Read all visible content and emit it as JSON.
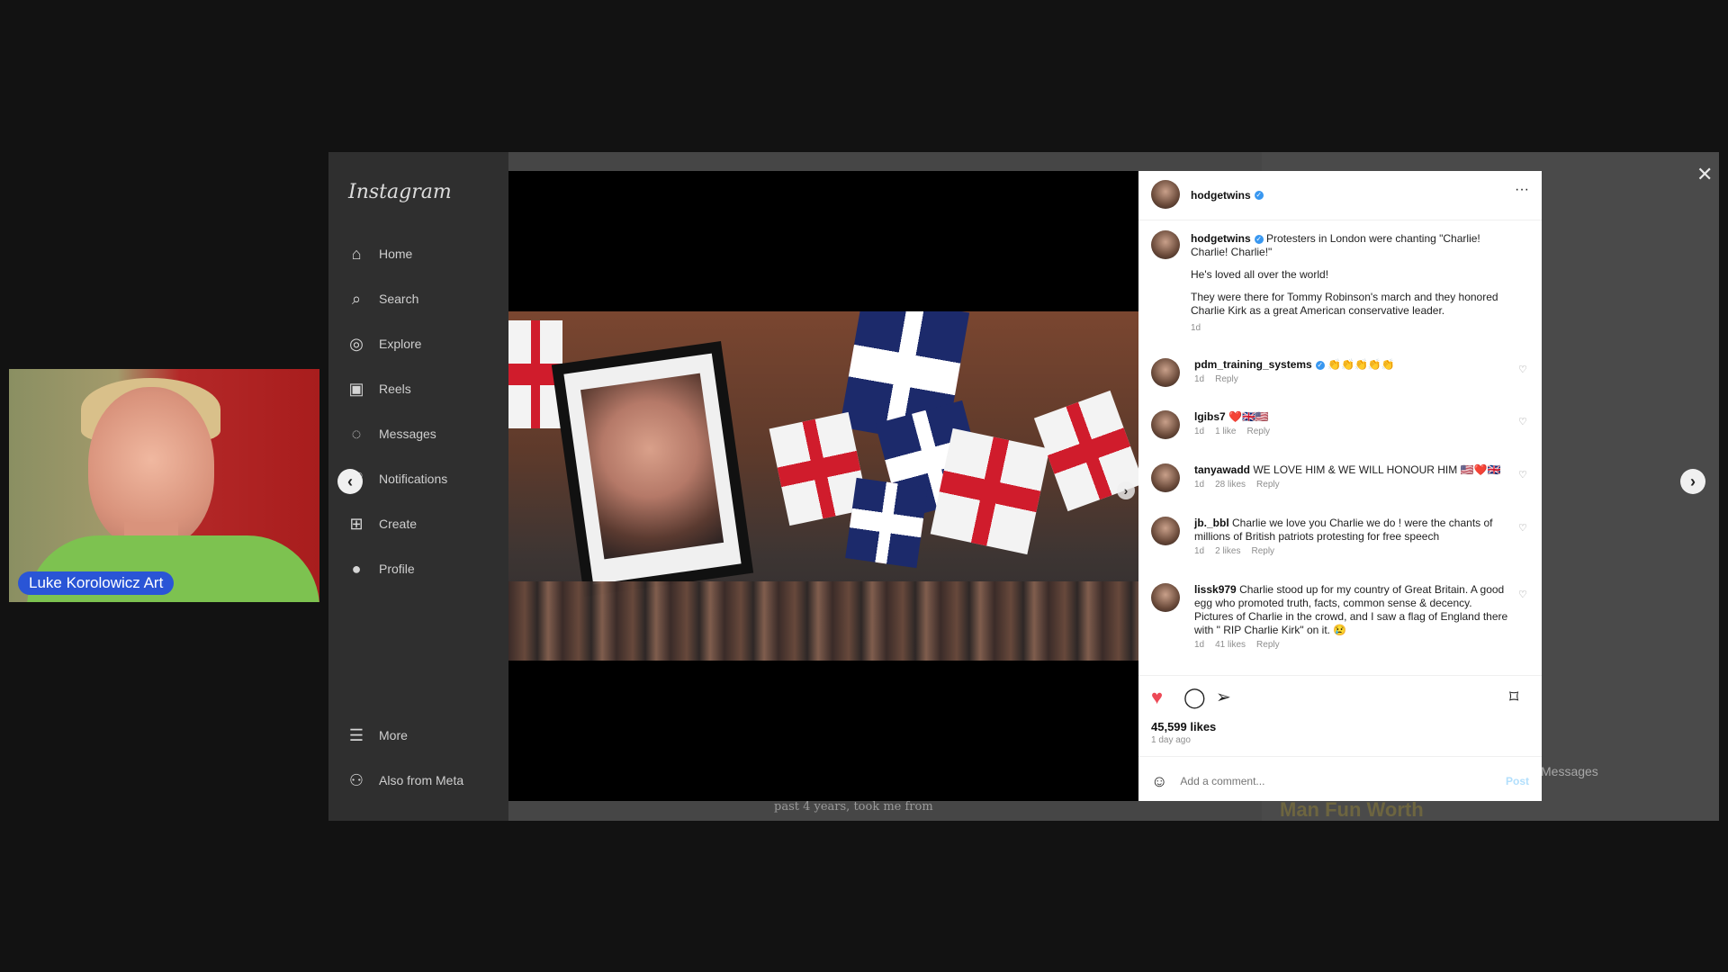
{
  "webcam": {
    "name_label": "Luke Korolowicz Art"
  },
  "sidebar": {
    "logo": "Instagram",
    "items": [
      {
        "label": "Home",
        "icon": "home-icon"
      },
      {
        "label": "Search",
        "icon": "search-icon"
      },
      {
        "label": "Explore",
        "icon": "compass-icon"
      },
      {
        "label": "Reels",
        "icon": "reels-icon"
      },
      {
        "label": "Messages",
        "icon": "messenger-icon"
      },
      {
        "label": "Notifications",
        "icon": "heart-icon"
      },
      {
        "label": "Create",
        "icon": "plus-square-icon"
      },
      {
        "label": "Profile",
        "icon": "avatar-icon"
      }
    ],
    "more": "More",
    "meta": "Also from Meta"
  },
  "media": {
    "subtitle": "past 4 years, took me from"
  },
  "background": {
    "messages": "Messages",
    "partial_text": "Man Fun Worth"
  },
  "post": {
    "author": "hodgetwins",
    "caption_line1": "Protesters in London were chanting \"Charlie! Charlie! Charlie!\"",
    "caption_line2": "He's loved all over the world!",
    "caption_line3": "They were there for Tommy Robinson's march and they honored Charlie Kirk as a great American conservative leader.",
    "caption_time": "1d",
    "comments": [
      {
        "user": "pdm_training_systems",
        "text": "👏👏👏👏👏",
        "time": "1d",
        "likes": "",
        "reply": "Reply",
        "verified": true
      },
      {
        "user": "lgibs7",
        "text": "❤️🇬🇧🇺🇸",
        "time": "1d",
        "likes": "1 like",
        "reply": "Reply",
        "verified": false
      },
      {
        "user": "tanyawadd",
        "text": "WE LOVE HIM & WE WILL HONOUR HIM 🇺🇸❤️🇬🇧",
        "time": "1d",
        "likes": "28 likes",
        "reply": "Reply",
        "verified": false
      },
      {
        "user": "jb._bbl",
        "text": "Charlie we love you Charlie we do ! were the chants of millions of British patriots protesting for free speech",
        "time": "1d",
        "likes": "2 likes",
        "reply": "Reply",
        "verified": false
      },
      {
        "user": "lissk979",
        "text": "Charlie stood up for my country of Great Britain. A good egg who promoted truth, facts, common sense & decency. Pictures of Charlie in the crowd, and I saw a flag of England there with \" RIP Charlie Kirk\" on it. 😢",
        "time": "1d",
        "likes": "41 likes",
        "reply": "Reply",
        "verified": false
      }
    ],
    "likes": "45,599 likes",
    "time_ago": "1 day ago",
    "comment_placeholder": "Add a comment...",
    "post_label": "Post"
  },
  "colors": {
    "like": "#ed4956",
    "verified": "#3897f0",
    "webcam_label": "#2a55d6"
  }
}
